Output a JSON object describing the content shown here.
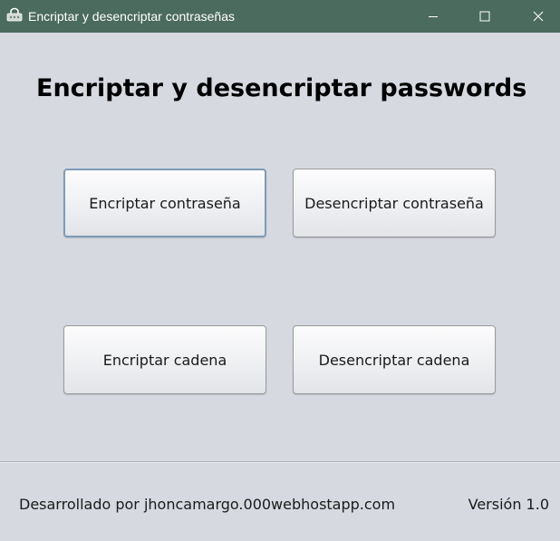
{
  "window": {
    "title": "Encriptar y desencriptar contraseñas",
    "titlebar_color": "#4b6b5f",
    "icons": {
      "app": "app-icon",
      "minimize": "minimize-icon",
      "maximize": "maximize-icon",
      "close": "close-icon"
    }
  },
  "main": {
    "heading": "Encriptar y desencriptar passwords",
    "buttons": {
      "encrypt_password": "Encriptar contraseña",
      "decrypt_password": "Desencriptar contraseña",
      "encrypt_string": "Encriptar cadena",
      "decrypt_string": "Desencriptar cadena"
    },
    "focused_button": "encrypt_password"
  },
  "footer": {
    "credit": "Desarrollado por jhoncamargo.000webhostapp.com",
    "version": "Versión 1.0"
  },
  "colors": {
    "background": "#d6d9e0",
    "focus_border": "#7f9bb8"
  }
}
